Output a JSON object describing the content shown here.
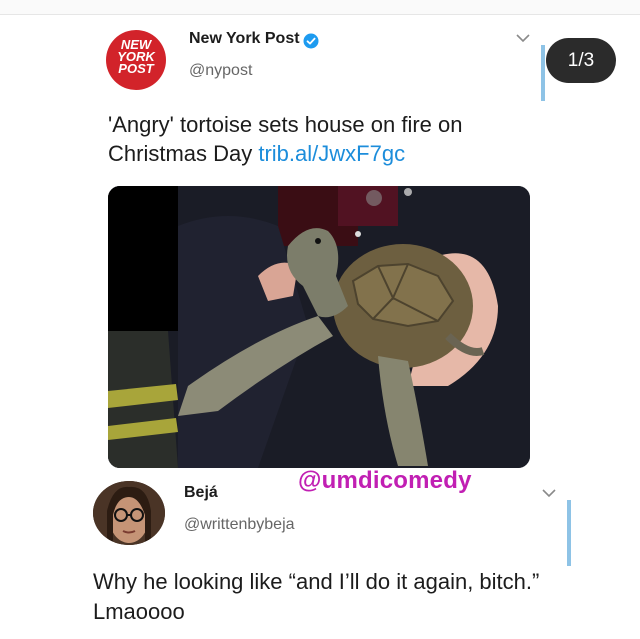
{
  "tweet1": {
    "logo_text": [
      "NEW",
      "YORK",
      "POST"
    ],
    "name": "New York Post",
    "handle": "@nypost",
    "text": "'Angry' tortoise sets house on fire on Christmas Day ",
    "link": "trib.al/JwxF7gc",
    "verified_icon": "verified-badge-icon",
    "menu_icon": "chevron-down-icon"
  },
  "counter": "1/3",
  "watermark": "@umdicomedy",
  "tweet2": {
    "name": "Bejá",
    "handle": "@writtenbybeja",
    "text": "Why he looking like “and I’ll do it again, bitch.” Lmaoooo",
    "menu_icon": "chevron-down-icon"
  },
  "colors": {
    "link": "#1c8ddb",
    "nyp_red": "#d2232a",
    "watermark": "#c11fb3",
    "scrollbar": "#8ec3e6"
  }
}
